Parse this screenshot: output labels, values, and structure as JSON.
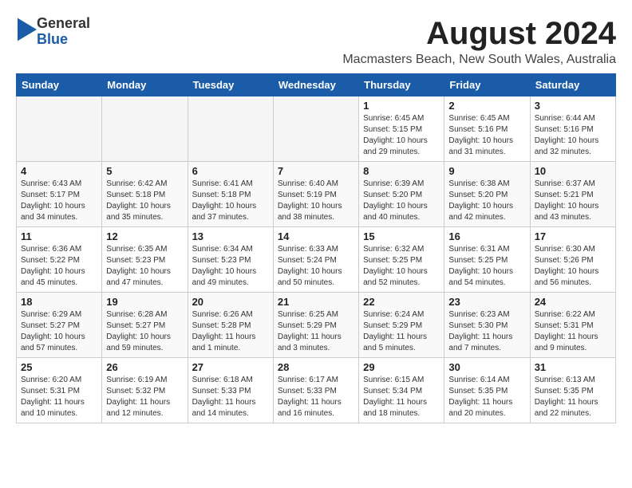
{
  "logo": {
    "general": "General",
    "blue": "Blue"
  },
  "header": {
    "month_year": "August 2024",
    "location": "Macmasters Beach, New South Wales, Australia"
  },
  "days_of_week": [
    "Sunday",
    "Monday",
    "Tuesday",
    "Wednesday",
    "Thursday",
    "Friday",
    "Saturday"
  ],
  "weeks": [
    [
      {
        "day": "",
        "info": ""
      },
      {
        "day": "",
        "info": ""
      },
      {
        "day": "",
        "info": ""
      },
      {
        "day": "",
        "info": ""
      },
      {
        "day": "1",
        "info": "Sunrise: 6:45 AM\nSunset: 5:15 PM\nDaylight: 10 hours\nand 29 minutes."
      },
      {
        "day": "2",
        "info": "Sunrise: 6:45 AM\nSunset: 5:16 PM\nDaylight: 10 hours\nand 31 minutes."
      },
      {
        "day": "3",
        "info": "Sunrise: 6:44 AM\nSunset: 5:16 PM\nDaylight: 10 hours\nand 32 minutes."
      }
    ],
    [
      {
        "day": "4",
        "info": "Sunrise: 6:43 AM\nSunset: 5:17 PM\nDaylight: 10 hours\nand 34 minutes."
      },
      {
        "day": "5",
        "info": "Sunrise: 6:42 AM\nSunset: 5:18 PM\nDaylight: 10 hours\nand 35 minutes."
      },
      {
        "day": "6",
        "info": "Sunrise: 6:41 AM\nSunset: 5:18 PM\nDaylight: 10 hours\nand 37 minutes."
      },
      {
        "day": "7",
        "info": "Sunrise: 6:40 AM\nSunset: 5:19 PM\nDaylight: 10 hours\nand 38 minutes."
      },
      {
        "day": "8",
        "info": "Sunrise: 6:39 AM\nSunset: 5:20 PM\nDaylight: 10 hours\nand 40 minutes."
      },
      {
        "day": "9",
        "info": "Sunrise: 6:38 AM\nSunset: 5:20 PM\nDaylight: 10 hours\nand 42 minutes."
      },
      {
        "day": "10",
        "info": "Sunrise: 6:37 AM\nSunset: 5:21 PM\nDaylight: 10 hours\nand 43 minutes."
      }
    ],
    [
      {
        "day": "11",
        "info": "Sunrise: 6:36 AM\nSunset: 5:22 PM\nDaylight: 10 hours\nand 45 minutes."
      },
      {
        "day": "12",
        "info": "Sunrise: 6:35 AM\nSunset: 5:23 PM\nDaylight: 10 hours\nand 47 minutes."
      },
      {
        "day": "13",
        "info": "Sunrise: 6:34 AM\nSunset: 5:23 PM\nDaylight: 10 hours\nand 49 minutes."
      },
      {
        "day": "14",
        "info": "Sunrise: 6:33 AM\nSunset: 5:24 PM\nDaylight: 10 hours\nand 50 minutes."
      },
      {
        "day": "15",
        "info": "Sunrise: 6:32 AM\nSunset: 5:25 PM\nDaylight: 10 hours\nand 52 minutes."
      },
      {
        "day": "16",
        "info": "Sunrise: 6:31 AM\nSunset: 5:25 PM\nDaylight: 10 hours\nand 54 minutes."
      },
      {
        "day": "17",
        "info": "Sunrise: 6:30 AM\nSunset: 5:26 PM\nDaylight: 10 hours\nand 56 minutes."
      }
    ],
    [
      {
        "day": "18",
        "info": "Sunrise: 6:29 AM\nSunset: 5:27 PM\nDaylight: 10 hours\nand 57 minutes."
      },
      {
        "day": "19",
        "info": "Sunrise: 6:28 AM\nSunset: 5:27 PM\nDaylight: 10 hours\nand 59 minutes."
      },
      {
        "day": "20",
        "info": "Sunrise: 6:26 AM\nSunset: 5:28 PM\nDaylight: 11 hours\nand 1 minute."
      },
      {
        "day": "21",
        "info": "Sunrise: 6:25 AM\nSunset: 5:29 PM\nDaylight: 11 hours\nand 3 minutes."
      },
      {
        "day": "22",
        "info": "Sunrise: 6:24 AM\nSunset: 5:29 PM\nDaylight: 11 hours\nand 5 minutes."
      },
      {
        "day": "23",
        "info": "Sunrise: 6:23 AM\nSunset: 5:30 PM\nDaylight: 11 hours\nand 7 minutes."
      },
      {
        "day": "24",
        "info": "Sunrise: 6:22 AM\nSunset: 5:31 PM\nDaylight: 11 hours\nand 9 minutes."
      }
    ],
    [
      {
        "day": "25",
        "info": "Sunrise: 6:20 AM\nSunset: 5:31 PM\nDaylight: 11 hours\nand 10 minutes."
      },
      {
        "day": "26",
        "info": "Sunrise: 6:19 AM\nSunset: 5:32 PM\nDaylight: 11 hours\nand 12 minutes."
      },
      {
        "day": "27",
        "info": "Sunrise: 6:18 AM\nSunset: 5:33 PM\nDaylight: 11 hours\nand 14 minutes."
      },
      {
        "day": "28",
        "info": "Sunrise: 6:17 AM\nSunset: 5:33 PM\nDaylight: 11 hours\nand 16 minutes."
      },
      {
        "day": "29",
        "info": "Sunrise: 6:15 AM\nSunset: 5:34 PM\nDaylight: 11 hours\nand 18 minutes."
      },
      {
        "day": "30",
        "info": "Sunrise: 6:14 AM\nSunset: 5:35 PM\nDaylight: 11 hours\nand 20 minutes."
      },
      {
        "day": "31",
        "info": "Sunrise: 6:13 AM\nSunset: 5:35 PM\nDaylight: 11 hours\nand 22 minutes."
      }
    ]
  ]
}
